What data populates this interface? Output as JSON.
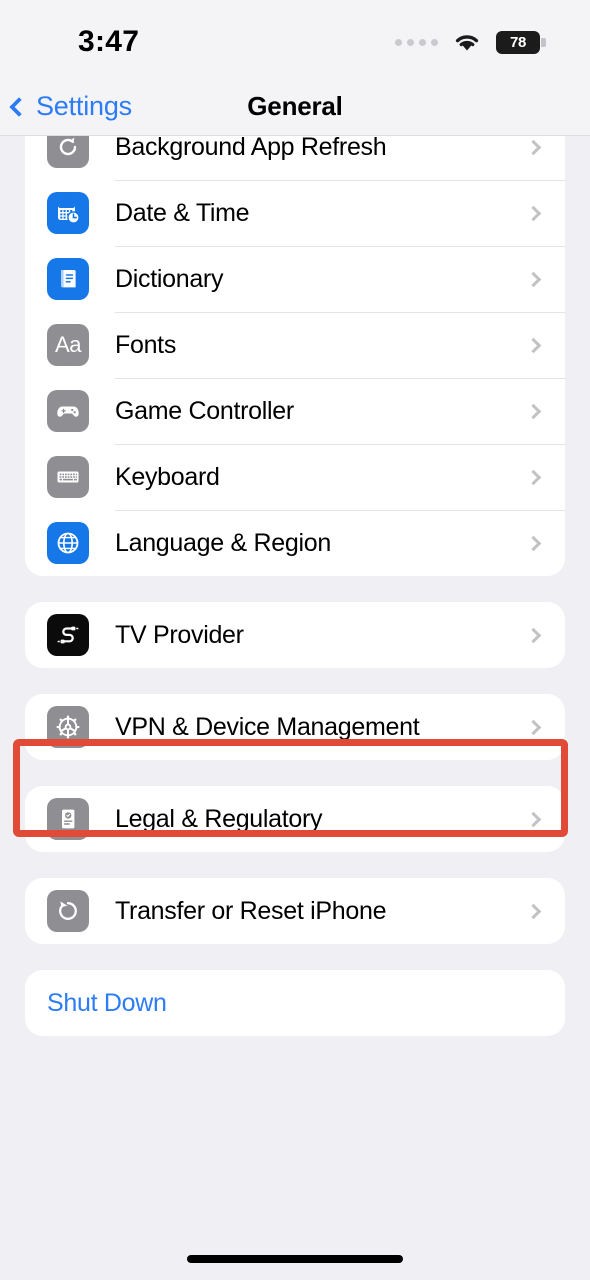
{
  "status_bar": {
    "time": "3:47",
    "cellular_icon": "cellular-dots-icon",
    "wifi_icon": "wifi-icon",
    "battery_icon": "battery-icon",
    "battery_percent": "78"
  },
  "nav": {
    "back_icon": "chevron-left-icon",
    "back_label": "Settings",
    "title": "General"
  },
  "groups": [
    {
      "name": "general-options-group",
      "clipped_top": true,
      "rows": [
        {
          "label": "Background App Refresh",
          "icon": "background-app-refresh-icon",
          "icon_style": "gray",
          "chevron": "chevron-right-icon"
        },
        {
          "label": "Date & Time",
          "icon": "date-time-icon",
          "icon_style": "blue",
          "chevron": "chevron-right-icon"
        },
        {
          "label": "Dictionary",
          "icon": "dictionary-icon",
          "icon_style": "blue",
          "chevron": "chevron-right-icon"
        },
        {
          "label": "Fonts",
          "icon": "fonts-icon",
          "icon_style": "gray",
          "chevron": "chevron-right-icon"
        },
        {
          "label": "Game Controller",
          "icon": "game-controller-icon",
          "icon_style": "gray",
          "chevron": "chevron-right-icon"
        },
        {
          "label": "Keyboard",
          "icon": "keyboard-icon",
          "icon_style": "gray",
          "chevron": "chevron-right-icon"
        },
        {
          "label": "Language & Region",
          "icon": "language-region-icon",
          "icon_style": "blue",
          "chevron": "chevron-right-icon"
        }
      ]
    },
    {
      "name": "tv-provider-group",
      "rows": [
        {
          "label": "TV Provider",
          "icon": "tv-provider-icon",
          "icon_style": "black",
          "chevron": "chevron-right-icon"
        }
      ]
    },
    {
      "name": "vpn-group",
      "highlighted": true,
      "rows": [
        {
          "label": "VPN & Device Management",
          "icon": "vpn-device-management-icon",
          "icon_style": "gray",
          "chevron": "chevron-right-icon"
        }
      ]
    },
    {
      "name": "legal-group",
      "rows": [
        {
          "label": "Legal & Regulatory",
          "icon": "legal-regulatory-icon",
          "icon_style": "gray",
          "chevron": "chevron-right-icon"
        }
      ]
    },
    {
      "name": "transfer-reset-group",
      "rows": [
        {
          "label": "Transfer or Reset iPhone",
          "icon": "transfer-reset-icon",
          "icon_style": "gray",
          "chevron": "chevron-right-icon"
        }
      ]
    },
    {
      "name": "shut-down-group",
      "rows": [
        {
          "label": "Shut Down",
          "icon": null,
          "icon_style": null,
          "chevron": null,
          "label_color": "blue"
        }
      ]
    }
  ],
  "highlight": {
    "color": "#e04a36",
    "target": "VPN & Device Management"
  },
  "home_indicator": "home-indicator",
  "colors": {
    "background": "#f0f0f4",
    "card": "#ffffff",
    "accent_blue": "#2c7cf6",
    "icon_gray": "#8e8e93",
    "icon_blue": "#1577e8",
    "highlight_red": "#e04a36"
  }
}
